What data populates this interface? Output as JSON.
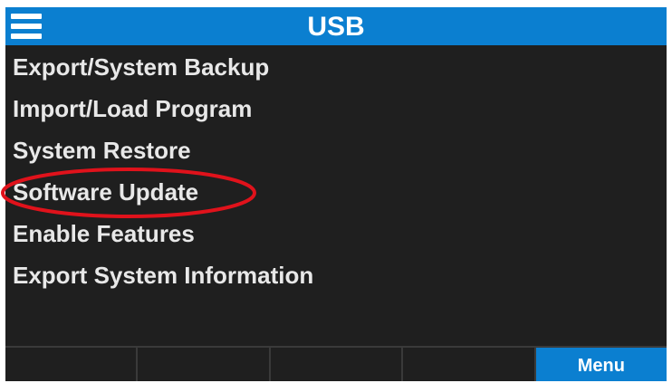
{
  "header": {
    "title": "USB",
    "menu_icon": "hamburger-menu-icon",
    "color": "#0b7fd0"
  },
  "menu": {
    "items": [
      {
        "label": "Export/System Backup"
      },
      {
        "label": "Import/Load Program"
      },
      {
        "label": "System Restore"
      },
      {
        "label": "Software Update",
        "highlighted": true
      },
      {
        "label": "Enable Features"
      },
      {
        "label": "Export System Information"
      }
    ]
  },
  "softkeys": [
    {
      "label": ""
    },
    {
      "label": ""
    },
    {
      "label": ""
    },
    {
      "label": ""
    },
    {
      "label": "Menu",
      "active": true
    }
  ],
  "annotation": {
    "color": "#e0121b",
    "target": "Software Update"
  },
  "colors": {
    "background": "#1f1f1f",
    "text": "#e8e8e8",
    "accent": "#0b7fd0"
  }
}
